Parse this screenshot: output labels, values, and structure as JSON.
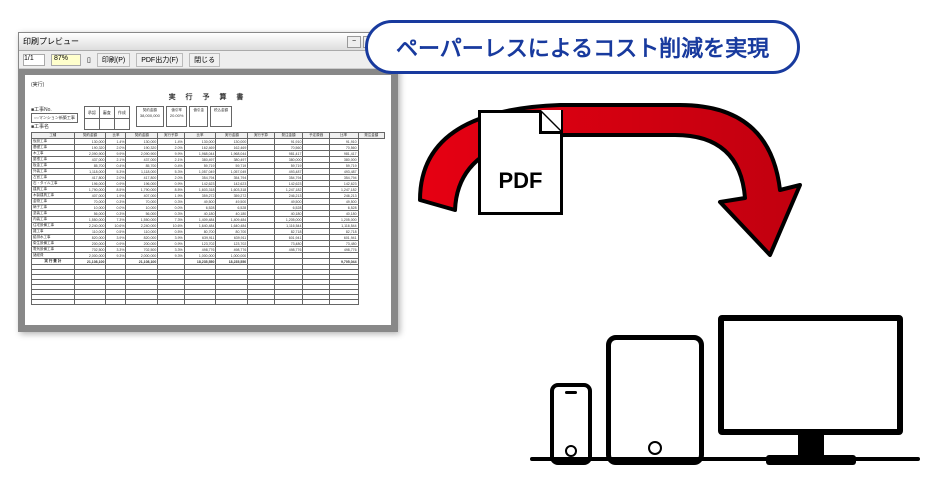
{
  "callout": "ペーパーレスによるコスト削減を実現",
  "pdf_label": "PDF",
  "window": {
    "title": "印刷プレビュー",
    "page_indicator": "1/1",
    "zoom": "87%",
    "toolbar": {
      "print": "印刷(P)",
      "pdf_out": "PDF出力(F)",
      "close": "閉じる"
    }
  },
  "document": {
    "heading_prefix": "(実行)",
    "title": "実 行 予 算 書",
    "site_label": "■工事No.",
    "site": "○○マンション新築工事",
    "client_label": "■工事名",
    "approval": {
      "cells": [
        "承認",
        "審査",
        "作成"
      ]
    },
    "summary": [
      {
        "lbl": "契約金額",
        "val": "38,000,000"
      },
      {
        "lbl": "値引率",
        "val": "20.00%"
      },
      {
        "lbl": "値引金",
        "val": ""
      },
      {
        "lbl": "税込金額",
        "val": ""
      }
    ],
    "columns": [
      "工種",
      "契約金額",
      "比率",
      "契約金額",
      "実行予算",
      "比率",
      "実行金額",
      "実行予算",
      "発注金額",
      "予定原価",
      "比率",
      "発注金額"
    ],
    "rows": [
      {
        "name": "仮設工事",
        "a": "130,000",
        "b": "1.4%",
        "c": "130,000",
        "d": "1.4%",
        "e": "130,000",
        "f": "130,000",
        "g": "",
        "h": "91,910",
        "i": "",
        "j": "91,910"
      },
      {
        "name": "基礎工事",
        "a": "190,320",
        "b": "2.0%",
        "c": "190,320",
        "d": "2.0%",
        "e": "162,469",
        "f": "162,469",
        "g": "",
        "h": "70,560",
        "i": "",
        "j": "70,560"
      },
      {
        "name": "木工事",
        "a": "2,090,900",
        "b": "9.9%",
        "c": "2,090,900",
        "d": "9.9%",
        "e": "1,968,044",
        "f": "1,968,044",
        "g": "",
        "h": "981,417",
        "i": "",
        "j": "981,417"
      },
      {
        "name": "屋根工事",
        "a": "437,000",
        "b": "2.1%",
        "c": "437,000",
        "d": "2.1%",
        "e": "380,497",
        "f": "380,497",
        "g": "",
        "h": "380,000",
        "i": "",
        "j": "380,000"
      },
      {
        "name": "板金工事",
        "a": "85,700",
        "b": "0.4%",
        "c": "85,700",
        "d": "0.4%",
        "e": "59,719",
        "f": "59,719",
        "g": "",
        "h": "59,719",
        "i": "",
        "j": "59,719"
      },
      {
        "name": "外装工事",
        "a": "1,118,000",
        "b": "5.3%",
        "c": "1,118,000",
        "d": "5.3%",
        "e": "1,057,049",
        "f": "1,057,049",
        "g": "",
        "h": "493,487",
        "i": "",
        "j": "493,487"
      },
      {
        "name": "左官工事",
        "a": "417,800",
        "b": "2.0%",
        "c": "417,800",
        "d": "2.0%",
        "e": "354,794",
        "f": "354,794",
        "g": "",
        "h": "354,794",
        "i": "",
        "j": "354,794"
      },
      {
        "name": "石・タイル工事",
        "a": "196,000",
        "b": "0.9%",
        "c": "196,000",
        "d": "0.9%",
        "e": "142,623",
        "f": "142,623",
        "g": "",
        "h": "142,623",
        "i": "",
        "j": "142,623"
      },
      {
        "name": "建具工事",
        "a": "1,790,000",
        "b": "8.5%",
        "c": "1,790,000",
        "d": "8.5%",
        "e": "1,603,318",
        "f": "1,603,318",
        "g": "",
        "h": "1,247,182",
        "i": "",
        "j": "1,247,182"
      },
      {
        "name": "木製建具工事",
        "a": "407,000",
        "b": "1.9%",
        "c": "407,000",
        "d": "1.9%",
        "e": "359,272",
        "f": "359,272",
        "g": "",
        "h": "246,213",
        "i": "",
        "j": "246,213"
      },
      {
        "name": "金物工事",
        "a": "70,000",
        "b": "0.3%",
        "c": "70,000",
        "d": "0.3%",
        "e": "49,500",
        "f": "49,500",
        "g": "",
        "h": "49,500",
        "i": "",
        "j": "49,500"
      },
      {
        "name": "硝子工事",
        "a": "10,000",
        "b": "0.0%",
        "c": "10,000",
        "d": "0.0%",
        "e": "6,528",
        "f": "6,528",
        "g": "",
        "h": "6,528",
        "i": "",
        "j": "6,528"
      },
      {
        "name": "塗装工事",
        "a": "56,000",
        "b": "0.3%",
        "c": "56,000",
        "d": "0.3%",
        "e": "40,180",
        "f": "40,180",
        "g": "",
        "h": "40,180",
        "i": "",
        "j": "40,180"
      },
      {
        "name": "内装工事",
        "a": "1,550,000",
        "b": "7.3%",
        "c": "1,550,000",
        "d": "7.3%",
        "e": "1,409,484",
        "f": "1,409,484",
        "g": "",
        "h": "1,205,000",
        "i": "",
        "j": "1,205,000"
      },
      {
        "name": "住宅設備工事",
        "a": "2,240,000",
        "b": "10.6%",
        "c": "2,240,000",
        "d": "10.6%",
        "e": "1,640,484",
        "f": "1,640,484",
        "g": "",
        "h": "1,116,544",
        "i": "",
        "j": "1,116,544"
      },
      {
        "name": "雑工事",
        "a": "110,000",
        "b": "0.5%",
        "c": "110,000",
        "d": "0.5%",
        "e": "80,700",
        "f": "80,700",
        "g": "",
        "h": "82,718",
        "i": "",
        "j": "82,718"
      },
      {
        "name": "給排水工事",
        "a": "820,000",
        "b": "3.9%",
        "c": "820,000",
        "d": "3.9%",
        "e": "639,911",
        "f": "639,911",
        "g": "",
        "h": "601,941",
        "i": "",
        "j": "601,941"
      },
      {
        "name": "衛生設備工事",
        "a": "200,000",
        "b": "0.9%",
        "c": "200,000",
        "d": "0.9%",
        "e": "123,702",
        "f": "123,702",
        "g": "",
        "h": "73,480",
        "i": "",
        "j": "73,480"
      },
      {
        "name": "電気設備工事",
        "a": "702,500",
        "b": "3.3%",
        "c": "702,500",
        "d": "3.3%",
        "e": "498,776",
        "f": "498,776",
        "g": "",
        "h": "498,776",
        "i": "",
        "j": "498,776"
      },
      {
        "name": "諸経費",
        "a": "2,000,000",
        "b": "9.3%",
        "c": "2,000,000",
        "d": "9.3%",
        "e": "1,000,000",
        "f": "1,000,000",
        "g": "",
        "h": "",
        "i": "",
        "j": ""
      }
    ],
    "total": {
      "name": "実 行 費 計",
      "a": "21,108,100",
      "c": "21,108,100",
      "e": "18,235,550",
      "f": "18,235,550",
      "h": "",
      "j": "9,705,044"
    }
  }
}
